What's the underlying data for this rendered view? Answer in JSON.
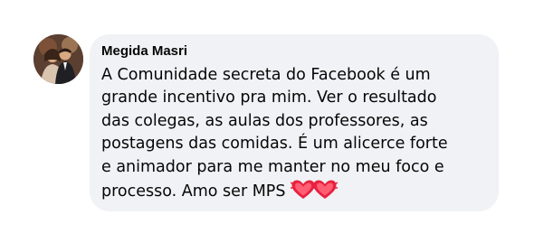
{
  "comment": {
    "author": "Megida Masri",
    "avatar_icon": "profile-photo-avatar",
    "text_lines": [
      "A Comunidade secreta do Facebook é um",
      "grande incentivo pra mim. Ver o resultado",
      "das colegas, as aulas dos professores, as",
      "postagens das comidas. É um alicerce forte",
      "e animador para me manter no meu foco e",
      "processo. Amo ser MPS"
    ],
    "emojis": [
      "heartbeat-icon",
      "heartbeat-icon"
    ],
    "colors": {
      "bubble_bg": "#f0f2f5",
      "text": "#050505",
      "heart": "#e8213f"
    }
  }
}
